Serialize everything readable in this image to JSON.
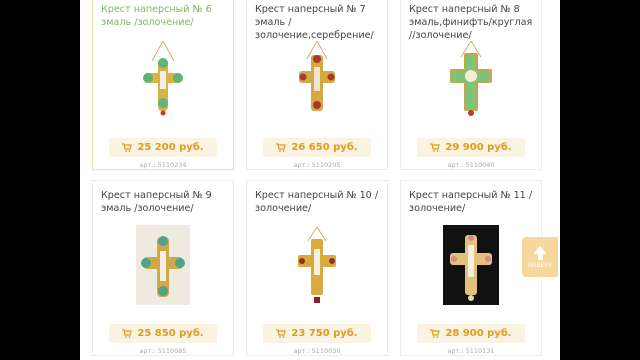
{
  "products": [
    {
      "title": "Крест наперсный № 6 эмаль /золочение/",
      "price": "25 200 руб.",
      "sku": "арт.: 5110234",
      "active": true,
      "style": "green"
    },
    {
      "title": "Крест наперсный № 7 эмаль /золочение,серебрение/",
      "price": "26 650 руб.",
      "sku": "арт.: 5110205",
      "active": false,
      "style": "red"
    },
    {
      "title": "Крест наперсный № 8 эмаль,финифть/круглая //золочение/",
      "price": "29 900 руб.",
      "sku": "арт.: 5110040",
      "active": false,
      "style": "green"
    },
    {
      "title": "Крест наперсный № 9 эмаль /золочение/",
      "price": "25 850 руб.",
      "sku": "арт.: 5110085",
      "active": false,
      "style": "light"
    },
    {
      "title": "Крест наперсный № 10 /золочение/",
      "price": "23 750 руб.",
      "sku": "арт.: 5110030",
      "active": false,
      "style": "red"
    },
    {
      "title": "Крест наперсный № 11 /золочение/",
      "price": "28 900 руб.",
      "sku": "арт.: 5110131",
      "active": false,
      "style": "dark"
    }
  ],
  "scroll_up": {
    "label": "НАВЕРХ",
    "icon": "arrow-up-icon"
  },
  "colors": {
    "accent": "#e09b1e",
    "price_bg": "#fbf3e2",
    "active_title": "#7bb661",
    "up_button": "#f7d89c"
  }
}
